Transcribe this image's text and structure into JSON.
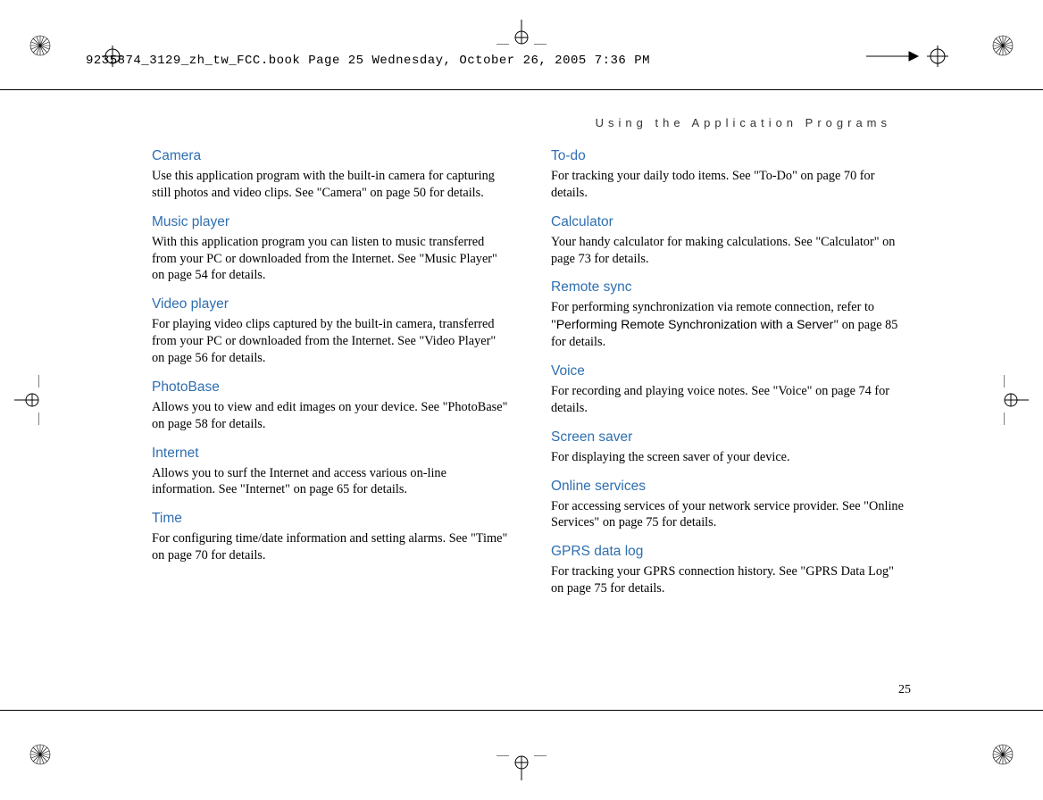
{
  "header_line": "9235874_3129_zh_tw_FCC.book  Page 25  Wednesday, October 26, 2005  7:36 PM",
  "running_head": "Using the Application Programs",
  "page_number": "25",
  "left": {
    "camera": {
      "title": "Camera",
      "body": "Use this application program with the built-in camera for capturing still photos and video clips. See \"Camera\" on page 50 for details."
    },
    "music": {
      "title": "Music player",
      "body": "With this application program you can listen to music transferred from your PC or downloaded from the Internet. See \"Music Player\" on page 54 for details."
    },
    "video": {
      "title": "Video player",
      "body": "For playing video clips captured by the built-in camera, transferred from your PC or downloaded from the Internet. See \"Video Player\" on page 56 for details."
    },
    "photobase": {
      "title": "PhotoBase",
      "body": "Allows you to view and edit images on your device. See \"PhotoBase\" on page 58 for details."
    },
    "internet": {
      "title": "Internet",
      "body": "Allows you to surf the Internet and access various on-line information. See \"Internet\" on page 65 for details."
    },
    "time": {
      "title": "Time",
      "body": "For configuring time/date information and setting alarms. See \"Time\" on page 70 for details."
    }
  },
  "right": {
    "todo": {
      "title": "To-do",
      "body": "For tracking your daily todo items. See \"To-Do\" on page 70 for details."
    },
    "calc": {
      "title": "Calculator",
      "body": "Your handy calculator for making calculations. See \"Calculator\" on page 73 for details."
    },
    "remote": {
      "title": "Remote sync",
      "pre": "For performing synchronization via remote connection, refer to \"",
      "sans": "Performing Remote Synchronization with a Server",
      "post": "\" on page 85 for details."
    },
    "voice": {
      "title": "Voice",
      "body": "For recording and playing voice notes. See \"Voice\" on page 74 for details."
    },
    "saver": {
      "title": "Screen saver",
      "body": "For displaying the screen saver of your device."
    },
    "online": {
      "title": "Online services",
      "body": "For accessing services of your network service provider. See \"Online Services\" on page 75 for details."
    },
    "gprs": {
      "title": "GPRS data log",
      "body": "For tracking your GPRS connection history. See \"GPRS Data Log\" on page 75 for details."
    }
  }
}
